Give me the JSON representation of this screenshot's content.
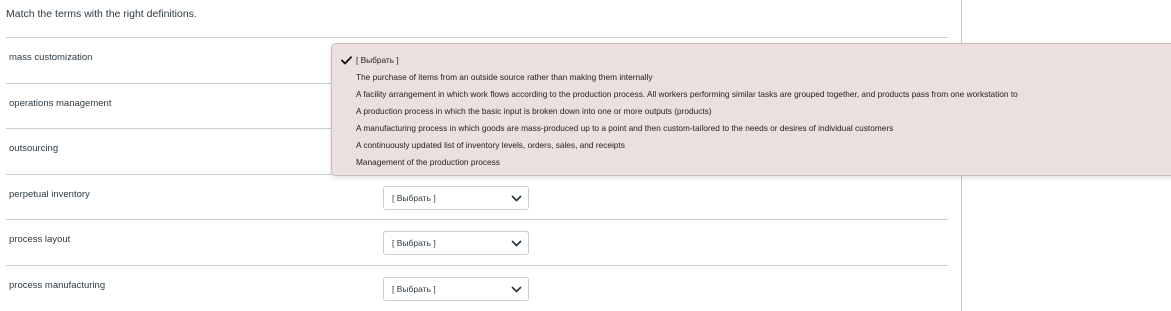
{
  "question": {
    "prompt": "Match the terms with the right definitions."
  },
  "rows": [
    {
      "term": "mass customization",
      "selected": "[ Выбрать ]"
    },
    {
      "term": "operations management",
      "selected": "[ Выбрать ]"
    },
    {
      "term": "outsourcing",
      "selected": "[ Выбрать ]"
    },
    {
      "term": "perpetual inventory",
      "selected": "[ Выбрать ]"
    },
    {
      "term": "process layout",
      "selected": "[ Выбрать ]"
    },
    {
      "term": "process manufacturing",
      "selected": "[ Выбрать ]"
    }
  ],
  "dropdown": {
    "options": [
      "[ Выбрать ]",
      "The purchase of items from an outside source rather than making them internally",
      "A facility arrangement in which work flows according to the production process. All workers performing similar tasks are grouped together, and products pass from one workstation to",
      "A production process in which the basic input is broken down into one or more outputs (products)",
      "A manufacturing process in which goods are mass-produced up to a point and then custom-tailored to the needs or desires of individual customers",
      "A continuously updated list of inventory levels, orders, sales, and receipts",
      "Management of the production process"
    ],
    "selected_index": 0
  },
  "icons": {
    "check": "check-icon",
    "chevron": "chevron-down-icon"
  }
}
